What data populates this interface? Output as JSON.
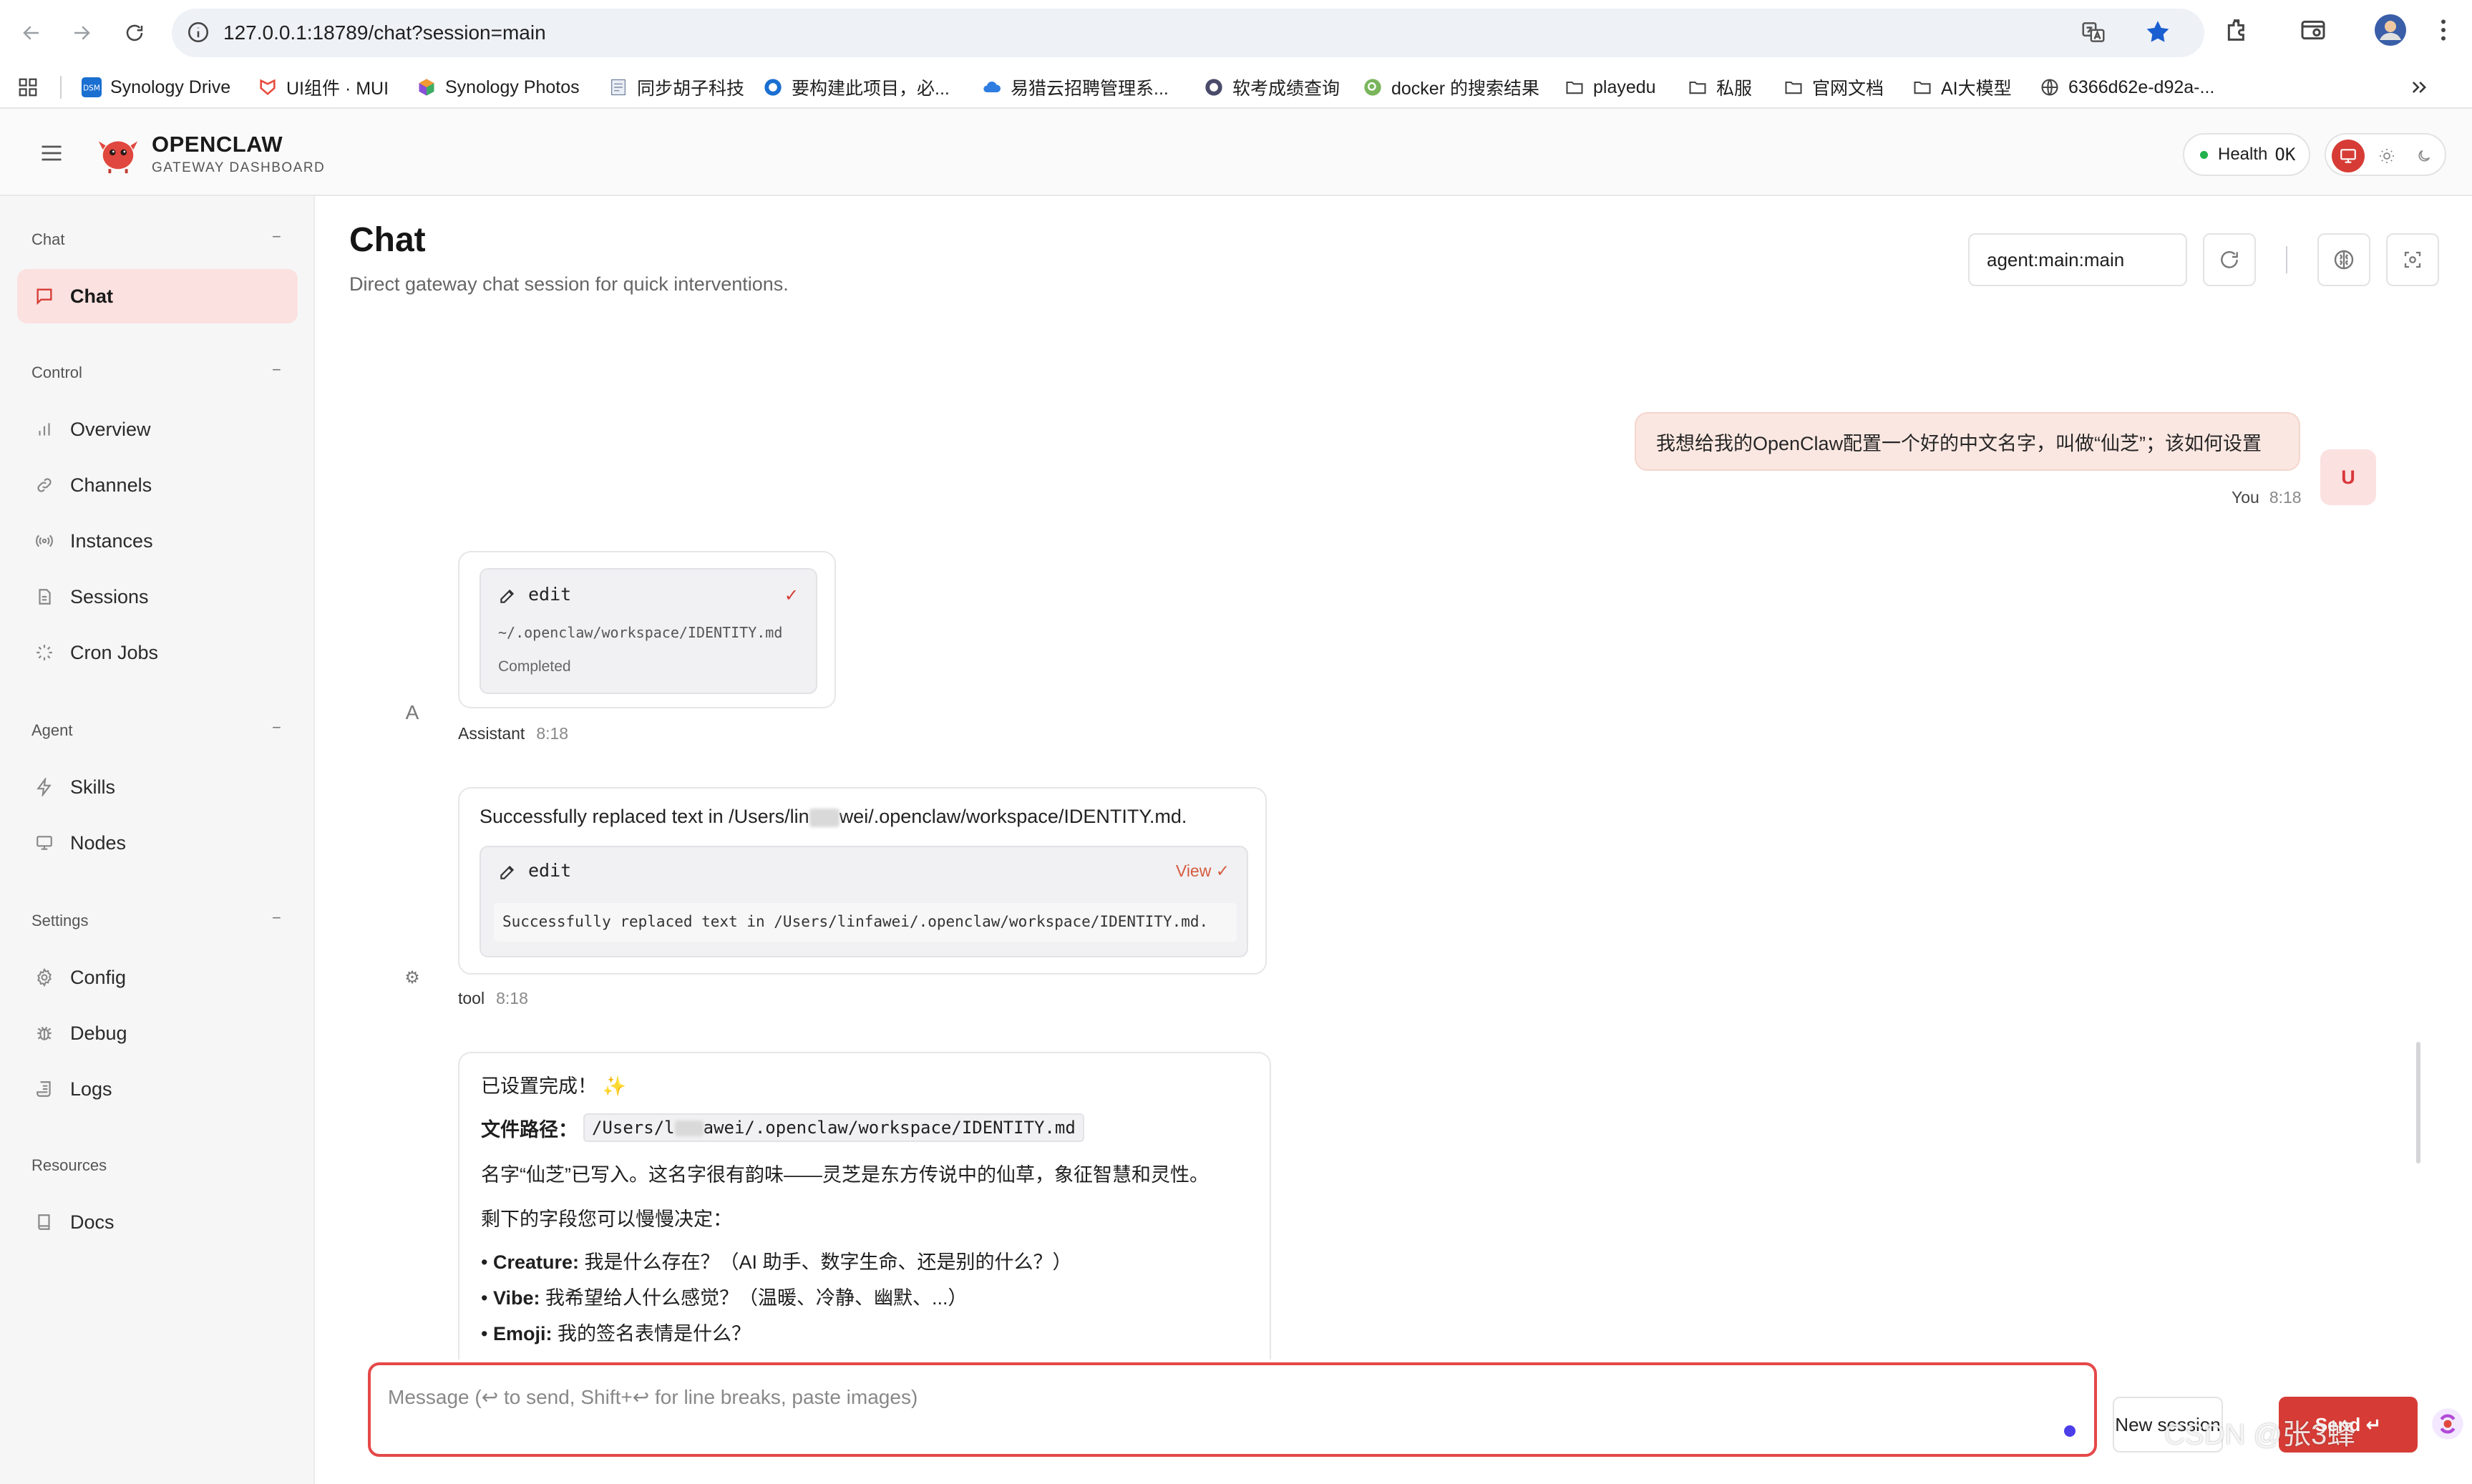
{
  "browser": {
    "url": "127.0.0.1:18789/chat?session=main",
    "bookmarks": [
      {
        "label": "Synology Drive",
        "icon": "dsm-icon"
      },
      {
        "label": "UI组件 · MUI",
        "icon": "mui-icon"
      },
      {
        "label": "Synology Photos",
        "icon": "photos-icon"
      },
      {
        "label": "同步胡子科技",
        "icon": "doc-icon"
      },
      {
        "label": "要构建此项目，必...",
        "icon": "globe-icon"
      },
      {
        "label": "易猎云招聘管理系...",
        "icon": "cloud-icon"
      },
      {
        "label": "软考成绩查询",
        "icon": "globe-icon"
      },
      {
        "label": "docker 的搜索结果",
        "icon": "search-fav-icon"
      },
      {
        "label": "playedu",
        "icon": "folder-icon"
      },
      {
        "label": "私服",
        "icon": "folder-icon"
      },
      {
        "label": "官网文档",
        "icon": "folder-icon"
      },
      {
        "label": "AI大模型",
        "icon": "folder-icon"
      },
      {
        "label": "6366d62e-d92a-...",
        "icon": "globe-icon"
      }
    ]
  },
  "header": {
    "brand": "OPENCLAW",
    "brand_sub": "GATEWAY DASHBOARD",
    "health_label": "Health",
    "health_value": "OK"
  },
  "sidebar": {
    "sections": [
      {
        "title": "Chat",
        "collapse": "−",
        "items": [
          {
            "label": "Chat",
            "icon": "chat-bubble-icon",
            "active": true
          }
        ]
      },
      {
        "title": "Control",
        "collapse": "−",
        "items": [
          {
            "label": "Overview",
            "icon": "bar-chart-icon"
          },
          {
            "label": "Channels",
            "icon": "link-icon"
          },
          {
            "label": "Instances",
            "icon": "radio-icon"
          },
          {
            "label": "Sessions",
            "icon": "document-icon"
          },
          {
            "label": "Cron Jobs",
            "icon": "loader-icon"
          }
        ]
      },
      {
        "title": "Agent",
        "collapse": "−",
        "items": [
          {
            "label": "Skills",
            "icon": "bolt-icon"
          },
          {
            "label": "Nodes",
            "icon": "monitor-icon"
          }
        ]
      },
      {
        "title": "Settings",
        "collapse": "−",
        "items": [
          {
            "label": "Config",
            "icon": "gear-icon"
          },
          {
            "label": "Debug",
            "icon": "bug-icon"
          },
          {
            "label": "Logs",
            "icon": "scroll-icon"
          }
        ]
      },
      {
        "title": "Resources",
        "collapse": "",
        "items": [
          {
            "label": "Docs",
            "icon": "book-icon"
          }
        ]
      }
    ]
  },
  "main": {
    "title": "Chat",
    "subtitle": "Direct gateway chat session for quick interventions.",
    "session_value": "agent:main:main"
  },
  "messages": {
    "user": {
      "text": "我想给我的OpenClaw配置一个好的中文名字，叫做“仙芝”；该如何设置",
      "avatar": "U",
      "sender": "You",
      "time": "8:18"
    },
    "assistant_tool": {
      "tool": "edit",
      "path": "~/.openclaw/workspace/IDENTITY.md",
      "status": "Completed",
      "avatar": "A",
      "sender": "Assistant",
      "time": "8:18"
    },
    "tool_result": {
      "text_prefix": "Successfully replaced text in /Users/lin",
      "text_suffix": "wei/.openclaw/workspace/IDENTITY.md.",
      "tool": "edit",
      "view_label": "View",
      "output": "Successfully replaced text in /Users/linfawei/.openclaw/workspace/IDENTITY.md.",
      "sender": "tool",
      "time": "8:18"
    },
    "reply": {
      "line1": "已设置完成！",
      "sparkle": "✨",
      "path_label": "文件路径：",
      "path_prefix": "/Users/l",
      "path_suffix": "awei/.openclaw/workspace/IDENTITY.md",
      "line3": "名字“仙芝”已写入。这名字很有韵味——灵芝是东方传说中的仙草，象征智慧和灵性。",
      "line4": "剩下的字段您可以慢慢决定：",
      "bullets": [
        {
          "key": "Creature:",
          "text": "我是什么存在？（AI 助手、数字生命、还是别的什么？）"
        },
        {
          "key": "Vibe:",
          "text": "我希望给人什么感觉？（温暖、冷静、幽默、...）"
        },
        {
          "key": "Emoji:",
          "text": "我的签名表情是什么？"
        }
      ]
    }
  },
  "composer": {
    "placeholder": "Message (↩ to send, Shift+↩ for line breaks, paste images)",
    "new_session_label": "New session",
    "send_label": "Send",
    "send_icon": "↵"
  },
  "watermark": "CSDN @张3蜂",
  "colors": {
    "accent": "#d63c35",
    "active_bg": "#fbe1e0",
    "user_bubble": "#fbe7e1",
    "health_dot": "#22b14c"
  }
}
